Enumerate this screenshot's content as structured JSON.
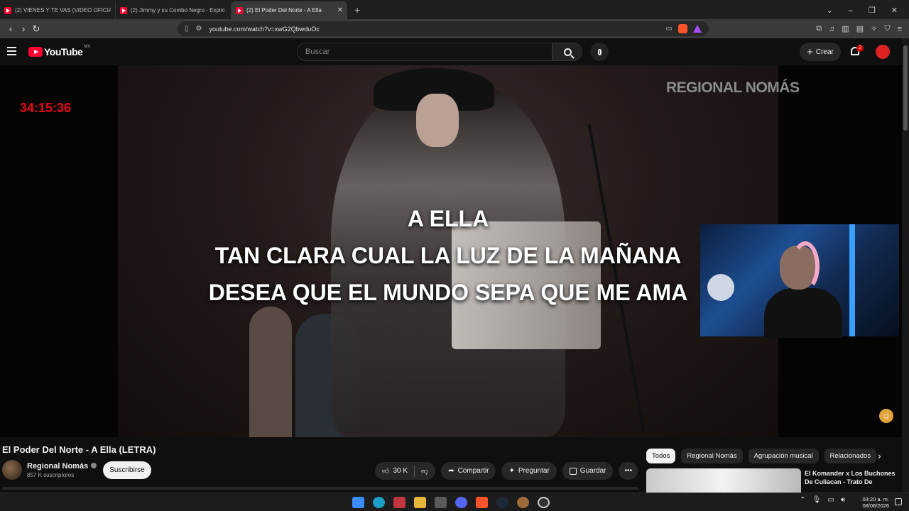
{
  "browser": {
    "tabs": [
      {
        "title": "(2) VIENES Y TE VAS (VIDEO OFICIAL)",
        "active": false
      },
      {
        "title": "(2) Jimmy y su Combo Negro - Explíc",
        "active": false
      },
      {
        "title": "(2) El Poder Del Norte - A Ella",
        "active": true
      }
    ],
    "new_tab_label": "+",
    "url": "youtube.com/watch?v=xwG2QbwduOc"
  },
  "youtube": {
    "logo_text": "YouTube",
    "country_code": "MX",
    "search_placeholder": "Buscar",
    "create_label": "Crear",
    "notification_count": "2"
  },
  "player": {
    "watermark": "REGIONAL NOMÁS",
    "timer": "34:15:36",
    "lyrics": [
      "A ELLA",
      "TAN CLARA CUAL LA LUZ DE LA MAÑANA",
      "DESEA QUE EL MUNDO SEPA QUE ME AMA"
    ]
  },
  "video": {
    "title": "El Poder Del Norte - A Ella (LETRA)",
    "channel": "Regional Nomás",
    "subscribers": "857 K suscriptores",
    "subscribe_label": "Suscribirse",
    "likes": "30 K",
    "share_label": "Compartir",
    "ask_label": "Preguntar",
    "save_label": "Guardar"
  },
  "sidebar": {
    "chips": [
      "Todos",
      "Regional Nomás",
      "Agrupación musical",
      "Relacionados"
    ],
    "next_video_title": "El Komander x Los Buchones De Culiacan - Trato De"
  },
  "taskbar": {
    "time": "03:20 a. m.",
    "date": "08/08/2026"
  }
}
